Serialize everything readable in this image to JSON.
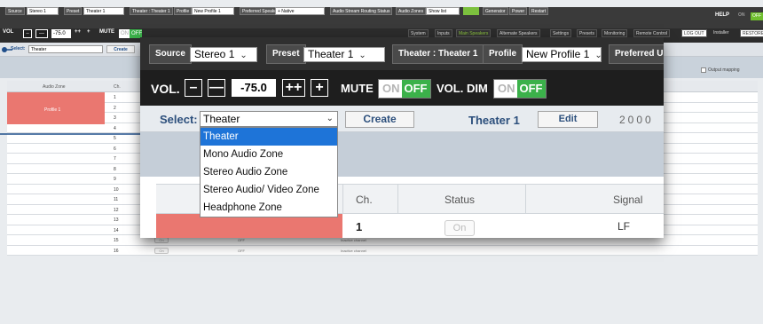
{
  "background_ui": {
    "toolbar": {
      "source_label": "Source",
      "source_value": "Stereo 1",
      "preset_label": "Preset",
      "preset_value": "Theater 1",
      "theater_label": "Theater : Theater 1",
      "profile_label": "Profile",
      "profile_value": "New Profile 1",
      "preferred_label": "Preferred Speakers",
      "preferred_value": "+ Native",
      "audio_stream_label": "Audio Stream Routing Status",
      "audio_zones_label": "Audio Zones",
      "audio_zones_value": "Show list",
      "generator_label": "Generator",
      "power_label": "Power",
      "restart_label": "Restart",
      "help_label": "HELP",
      "on_label": "ON",
      "off_label": "OFF"
    },
    "volume_bar": {
      "vol_label": "VOL",
      "vol_value": "-75.0",
      "mute_label": "MUTE",
      "vol_dim_label": "VOL. DIM",
      "on_label": "ON",
      "off_label": "OFF"
    },
    "nav_tabs": [
      "System",
      "Inputs",
      "Main Speakers",
      "Alternate Speakers",
      "Settings",
      "Presets",
      "Monitoring",
      "Remote Control",
      "LOG OUT",
      "Installer",
      "RESTORE"
    ],
    "select_bar": {
      "select_label": "Select:",
      "select_value": "Theater",
      "create_label": "Create"
    },
    "output_mapping_label": "Output mapping",
    "table": {
      "headers": [
        "Audio Zone",
        "Ch."
      ],
      "zone_name": "Profile 1",
      "channels": [
        "1",
        "2",
        "3",
        "4",
        "5",
        "6",
        "7",
        "8",
        "9",
        "10",
        "11",
        "12",
        "13",
        "14",
        "15",
        "16"
      ],
      "on_label": "On",
      "off_text": "OFF",
      "inactive_text": "Inactive channel"
    }
  },
  "zoom_panel": {
    "source_label": "Source",
    "source_value": "Stereo 1",
    "preset_label": "Preset",
    "preset_value": "Theater 1",
    "theater_label": "Theater : Theater 1",
    "profile_label": "Profile",
    "profile_value": "New Profile 1",
    "preferred_label": "Preferred U",
    "vol_label": "VOL.",
    "vol_minus_label": "–",
    "vol_minus_minus_label": "—",
    "vol_value": "-75.0",
    "vol_plus_plus_label": "++",
    "vol_plus_label": "+",
    "mute_label": "MUTE",
    "mute_on": "ON",
    "mute_off": "OFF",
    "vol_dim_label": "VOL. DIM",
    "dim_on": "ON",
    "dim_off": "OFF",
    "select_label": "Select:",
    "select_value": "Theater",
    "create_label": "Create",
    "zone_title": "Theater 1",
    "edit_label": "Edit",
    "zone_number": "2000",
    "dropdown_options": [
      "Theater",
      "Mono Audio Zone",
      "Stereo Audio Zone",
      "Stereo Audio/ Video Zone",
      "Headphone Zone"
    ],
    "selected_option_index": 0,
    "table_headers": {
      "ch": "Ch.",
      "status": "Status",
      "signal": "Signal"
    },
    "row1": {
      "ch": "1",
      "status": "On",
      "signal": "LF"
    }
  },
  "colors": {
    "accent_green": "#3bb14a",
    "zone_red": "#ea7770",
    "link_blue": "#2c4f7c",
    "dropdown_highlight": "#1e74d8",
    "callout_line": "#1f4e8a"
  }
}
